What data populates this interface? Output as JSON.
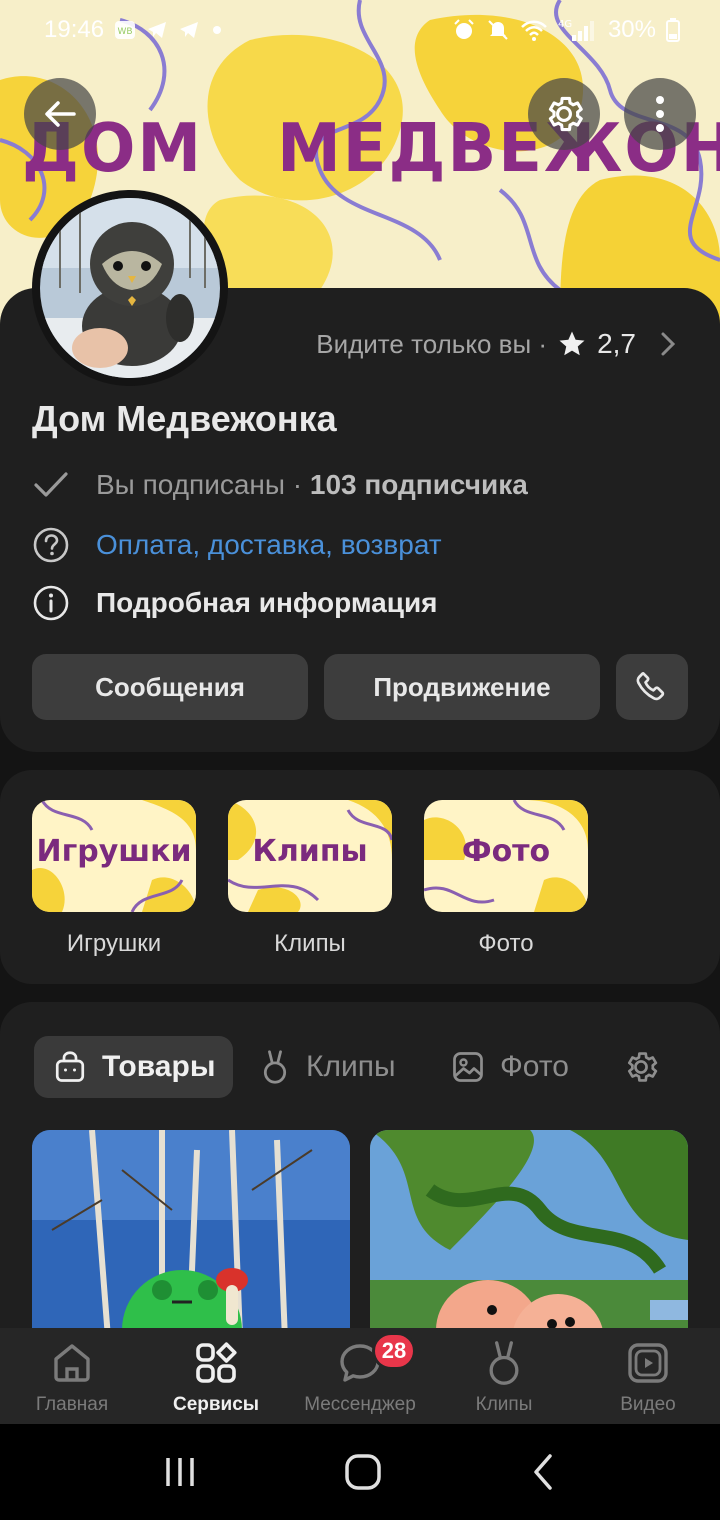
{
  "status_bar": {
    "time": "19:46",
    "left_icons": [
      "wb-app-icon",
      "telegram-icon",
      "telegram-icon",
      "dot-icon"
    ],
    "right_icons": [
      "alarm-icon",
      "mute-icon",
      "wifi-icon",
      "4g-signal-icon",
      "battery-icon"
    ],
    "network_label": "4G",
    "battery": "30%"
  },
  "cover": {
    "title_word1": "ДОМ",
    "title_word2": "МЕДВЕЖОНКА",
    "title_color": "#8b2d86"
  },
  "header_buttons": {
    "back": "arrow-left-icon",
    "settings": "gear-icon",
    "more": "more-vertical-icon"
  },
  "profile": {
    "visibility_text": "Видите только вы ·",
    "rating": "2,7",
    "name": "Дом Медвежонка",
    "subscribed_text": "Вы подписаны ·",
    "subscribers_count": "103 подписчика",
    "payment_link": "Оплата, доставка, возврат",
    "details": "Подробная информация",
    "link_color": "#4a90d9"
  },
  "actions": {
    "messages": "Сообщения",
    "promotion": "Продвижение",
    "call": "phone-icon"
  },
  "albums": [
    {
      "thumb_text": "Игрушки",
      "caption": "Игрушки"
    },
    {
      "thumb_text": "Клипы",
      "caption": "Клипы"
    },
    {
      "thumb_text": "Фото",
      "caption": "Фото"
    }
  ],
  "tabs": [
    {
      "label": "Товары",
      "icon": "bag-icon",
      "active": true
    },
    {
      "label": "Клипы",
      "icon": "clips-icon",
      "active": false
    },
    {
      "label": "Фото",
      "icon": "photo-icon",
      "active": false
    }
  ],
  "tabs_settings_icon": "gear-icon",
  "bottom_nav": [
    {
      "label": "Главная",
      "icon": "home-icon",
      "active": false
    },
    {
      "label": "Сервисы",
      "icon": "services-icon",
      "active": true
    },
    {
      "label": "Мессенджер",
      "icon": "chat-icon",
      "active": false,
      "badge": "28"
    },
    {
      "label": "Клипы",
      "icon": "clips-icon",
      "active": false
    },
    {
      "label": "Видео",
      "icon": "video-icon",
      "active": false
    }
  ],
  "system_nav": [
    "recent-apps-icon",
    "home-button-icon",
    "back-icon"
  ]
}
